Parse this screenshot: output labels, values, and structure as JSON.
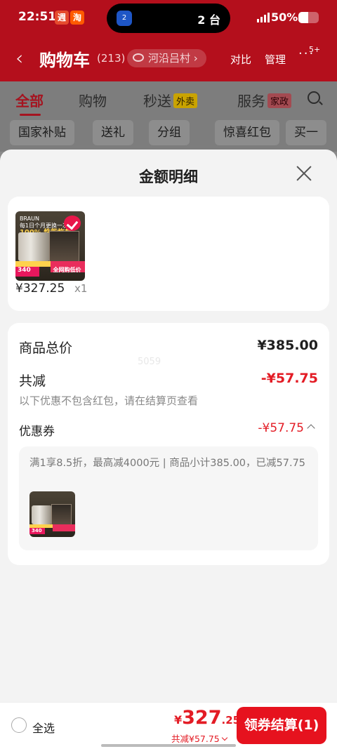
{
  "status_bar": {
    "time": "22:51",
    "app1": "週",
    "app2": "淘",
    "island_icon": "2",
    "island_text": "2 台",
    "signal": "5G",
    "battery": "50%"
  },
  "header": {
    "title": "购物车",
    "count": "(213)",
    "location": "河沿吕村",
    "compare": "对比",
    "manage": "管理",
    "badge": "5+"
  },
  "tabs": [
    {
      "label": "全部"
    },
    {
      "label": "购物"
    },
    {
      "label": "秒送",
      "tag": "外卖"
    },
    {
      "label": "服务",
      "tag": "家政"
    }
  ],
  "chips": [
    "国家补贴",
    "送礼",
    "分组",
    "惊喜红包",
    "买一"
  ],
  "sheet": {
    "title": "金额明细",
    "product": {
      "price": "¥327.25",
      "qty": "x1",
      "image_texts": {
        "top": "每1日个月更换一次刀头",
        "mid": "100% 性能恢复",
        "price_tag": "340",
        "promo": "全网购低价",
        "brand": "BRAUN"
      }
    },
    "summary": {
      "goods_total_label": "商品总价",
      "goods_total_value": "¥385.00",
      "discount_label": "共减",
      "discount_value": "-¥57.75",
      "discount_note": "以下优惠不包含红包，请在结算页查看",
      "coupon_label": "优惠券",
      "coupon_value": "-¥57.75",
      "coupon_detail": "满1享8.5折，最高减4000元 | 商品小计385.00，已减57.75"
    },
    "watermark": "5059"
  },
  "bottom_bar": {
    "select_all": "全选",
    "currency": "¥",
    "total_int": "327",
    "total_dec": ".25",
    "savings": "共减¥57.75",
    "checkout": "领券结算(1)"
  },
  "colors": {
    "accent": "#e31c25",
    "header_bg": "#b40f1c",
    "button": "#e6121e"
  }
}
